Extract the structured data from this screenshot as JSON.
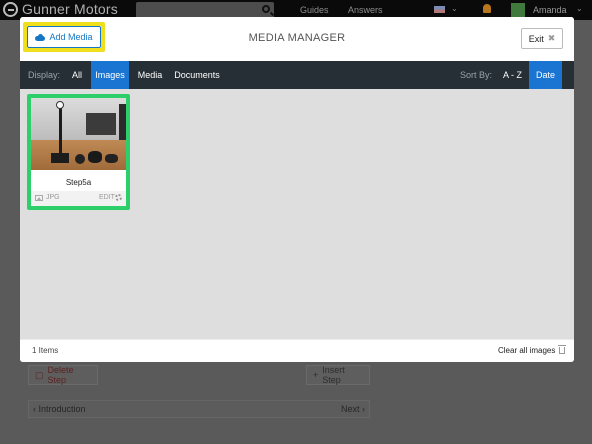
{
  "background": {
    "brand": "Gunner Motors",
    "nav": {
      "guides": "Guides",
      "answers": "Answers"
    },
    "user_name": "Amanda",
    "delete_step_label": "Delete Step",
    "insert_step_label": "Insert Step",
    "prev_step_label": "‹ Introduction",
    "next_step_label": "Next ›"
  },
  "modal": {
    "title": "MEDIA MANAGER",
    "add_media_label": "Add Media",
    "exit_label": "Exit",
    "toolbar": {
      "display_label": "Display:",
      "tabs": [
        {
          "label": "All",
          "active": false
        },
        {
          "label": "Images",
          "active": true
        },
        {
          "label": "Media",
          "active": false
        },
        {
          "label": "Documents",
          "active": false
        }
      ],
      "sort_label": "Sort By:",
      "sort_options": [
        {
          "label": "A - Z",
          "active": false
        },
        {
          "label": "Date",
          "active": true
        }
      ]
    },
    "items": [
      {
        "name": "Step5a",
        "file_type": "JPG",
        "edit_label": "EDIT"
      }
    ],
    "footer": {
      "count_label": "1 Items",
      "clear_label": "Clear all images"
    }
  },
  "colors": {
    "accent_blue": "#1a75d2",
    "toolbar_bg": "#262f36",
    "highlight_yellow": "#f0df1c",
    "highlight_green": "#2ecf6b"
  }
}
